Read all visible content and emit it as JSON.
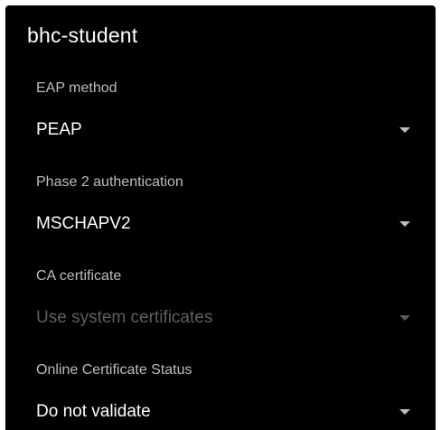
{
  "dialog": {
    "title": "bhc-student"
  },
  "fields": {
    "eap_method": {
      "label": "EAP method",
      "value": "PEAP",
      "enabled": true,
      "icon": "caret-down-icon"
    },
    "phase2_auth": {
      "label": "Phase 2 authentication",
      "value": "MSCHAPV2",
      "enabled": true,
      "icon": "caret-down-icon"
    },
    "ca_certificate": {
      "label": "CA certificate",
      "value": "Use system certificates",
      "enabled": false,
      "icon": "caret-down-icon"
    },
    "ocsp": {
      "label": "Online Certificate Status",
      "value": "Do not validate",
      "enabled": true,
      "icon": "caret-down-icon"
    }
  },
  "colors": {
    "background": "#000000",
    "text_primary": "#ffffff",
    "text_secondary": "#bdbdbd",
    "text_disabled": "#5f5f5f"
  }
}
